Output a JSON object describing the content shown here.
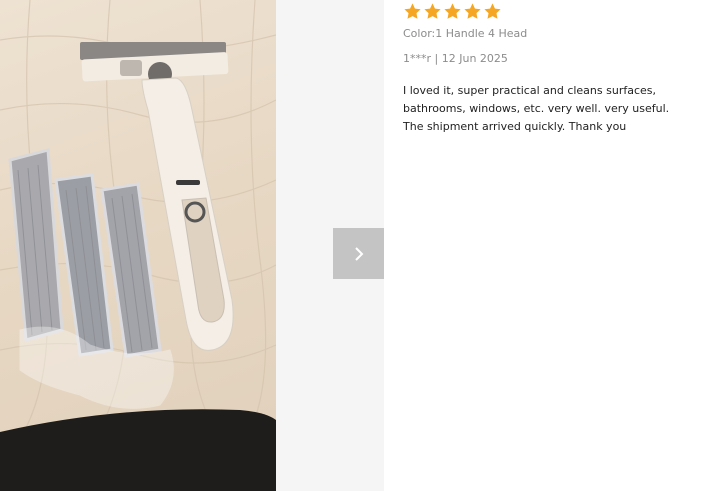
{
  "review": {
    "rating": 5,
    "max_rating": 5,
    "star_color": "#f5a623",
    "variant": "Color:1 Handle 4 Head",
    "reviewer": "1***r",
    "separator": "|",
    "date": "12 Jun 2025",
    "text": "I loved it, super practical and cleans surfaces, bathrooms, windows, etc. very well. very useful. The shipment arrived quickly. Thank you"
  },
  "viewer": {
    "photo_subject": "white handheld mop handle with four grey replacement heads on a beige quilted surface",
    "next_icon": "chevron-right-icon"
  }
}
